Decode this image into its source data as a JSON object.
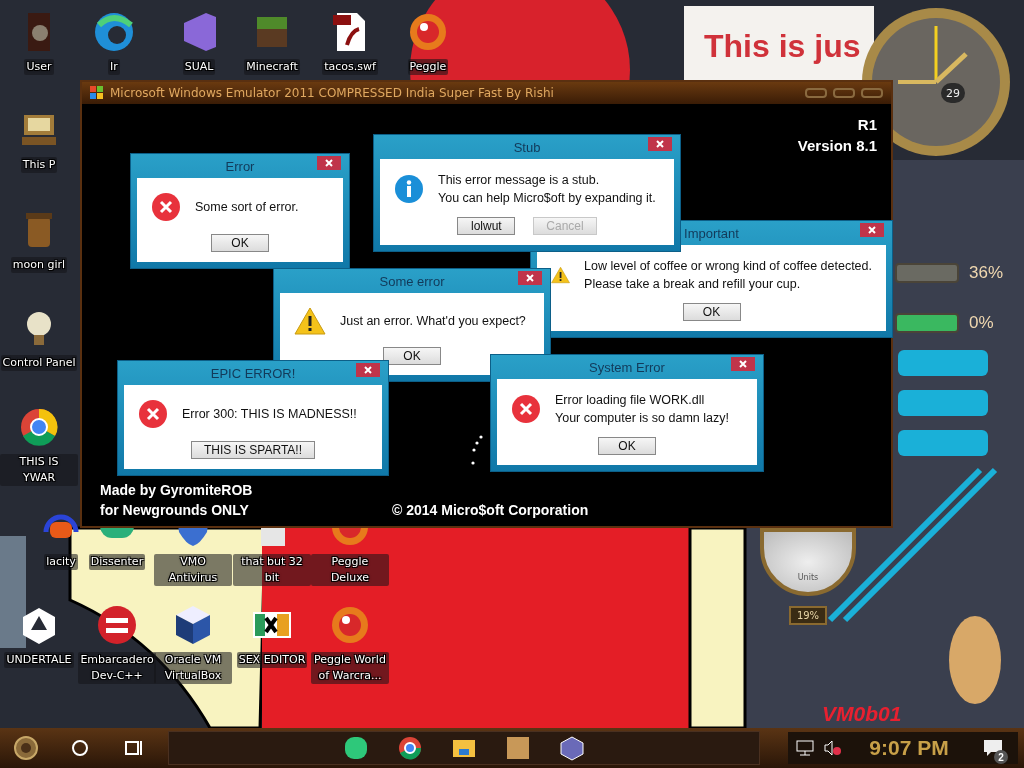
{
  "desktop_icons": [
    {
      "label": "User",
      "kind": "door"
    },
    {
      "label": "Ir",
      "kind": "wave"
    },
    {
      "label": "SUAL",
      "kind": "ribbon"
    },
    {
      "label": "Minecraft",
      "kind": "block"
    },
    {
      "label": "tacos.swf",
      "kind": "document"
    },
    {
      "label": "Peggle",
      "kind": "ball"
    },
    {
      "label": "This P",
      "kind": "computer"
    },
    {
      "label": "moon girl",
      "kind": "jar"
    },
    {
      "label": "Control Panel",
      "kind": "bulb"
    },
    {
      "label": "THIS IS YWAR",
      "kind": "ring"
    },
    {
      "label": "lacity",
      "kind": "headphones"
    },
    {
      "label": "Dissenter",
      "kind": "bubble"
    },
    {
      "label": "VMO Antivirus",
      "kind": "shield"
    },
    {
      "label": "that but 32 bit",
      "kind": "blank"
    },
    {
      "label": "Peggle Deluxe",
      "kind": "ball"
    },
    {
      "label": "UNDERTALE",
      "kind": "cube-outline"
    },
    {
      "label": "Embarcadero Dev-C++",
      "kind": "red-disc"
    },
    {
      "label": "Oracle VM VirtualBox",
      "kind": "cube"
    },
    {
      "label": "SEX EDITOR",
      "kind": "tile"
    },
    {
      "label": "Peggle World of Warcra...",
      "kind": "ball"
    }
  ],
  "emulator_window": {
    "title": "Microsoft Windows Emulator 2011 COMPRESSED India Super Fast By Rishi",
    "version_code": "R1",
    "version": "Version 8.1",
    "credits": [
      "Made by GyromiteROB",
      "for Newgrounds ONLY"
    ],
    "copyright": "© 2014 Micro$oft Corporation",
    "dialogs": [
      {
        "title": "Error",
        "kind": "error",
        "message": [
          "Some sort of error."
        ],
        "buttons": [
          {
            "label": "OK",
            "disabled": false
          }
        ]
      },
      {
        "title": "Stub",
        "kind": "info",
        "message": [
          "This error message is a stub.",
          "You can help Micro$oft by expanding it."
        ],
        "buttons": [
          {
            "label": "lolwut",
            "disabled": false
          },
          {
            "label": "Cancel",
            "disabled": true
          }
        ]
      },
      {
        "title": "Important",
        "kind": "warning",
        "message": [
          "Low level of coffee or wrong kind of coffee detected.",
          "Please take a break and refill your cup."
        ],
        "buttons": [
          {
            "label": "OK",
            "disabled": false
          }
        ]
      },
      {
        "title": "Some error",
        "kind": "warning",
        "message": [
          "Just an error. What'd you expect?"
        ],
        "buttons": [
          {
            "label": "OK",
            "disabled": false
          }
        ]
      },
      {
        "title": "EPIC ERROR!",
        "kind": "error",
        "message": [
          "Error 300: THIS IS MADNESS!!"
        ],
        "buttons": [
          {
            "label": "THIS IS SPARTA!!",
            "disabled": false
          }
        ]
      },
      {
        "title": "System Error",
        "kind": "error",
        "message": [
          "Error loading file WORK.dll",
          "Your computer is so damn lazy!"
        ],
        "buttons": [
          {
            "label": "OK",
            "disabled": false
          }
        ]
      }
    ]
  },
  "widgets": {
    "note": "This is jus",
    "calendar_day": "29",
    "meters": [
      "36%",
      "0%"
    ],
    "dial_unit": "Units",
    "dial_reading": "19%",
    "desktop_text": "VM0b01"
  },
  "taskbar": {
    "time": "9:07 PM",
    "notifications": "2"
  }
}
